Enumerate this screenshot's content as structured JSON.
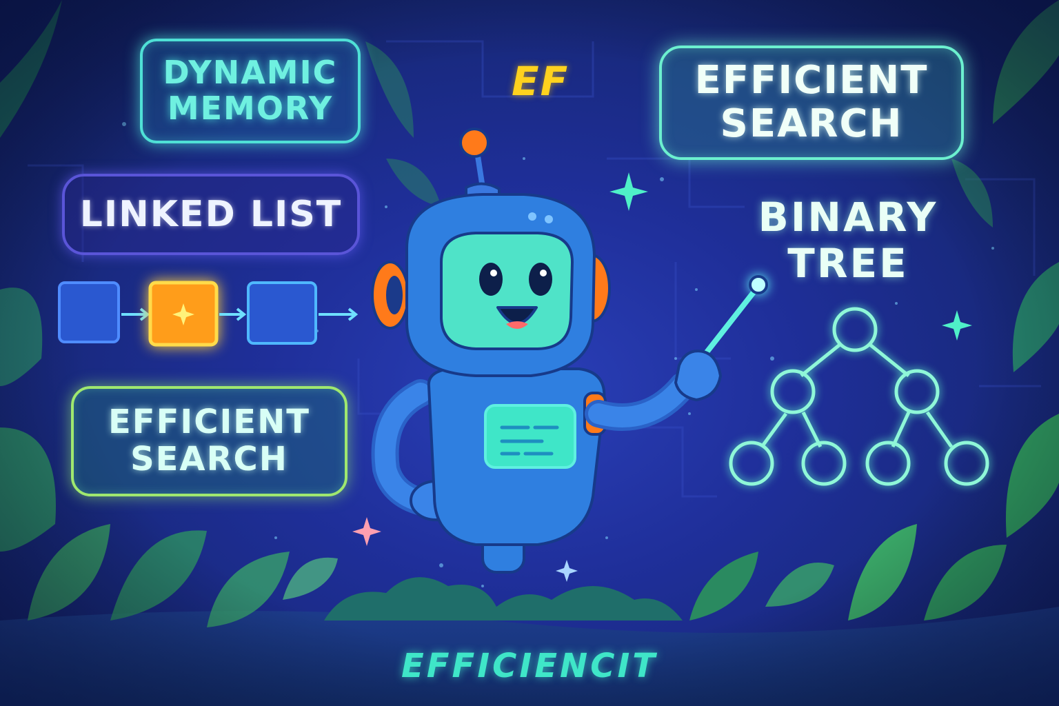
{
  "brand": {
    "logo_text": "EF",
    "footer_text": "EFFICIENCIT"
  },
  "labels": {
    "dynamic_memory": [
      "DYNAMIC",
      "MEMORY"
    ],
    "linked_list": "LINKED LIST",
    "efficient_search_left": [
      "EFFICIENT",
      "SEARCH"
    ],
    "efficient_search_right": [
      "EFFICIENT",
      "SEARCH"
    ],
    "binary_tree": [
      "BINARY",
      "TREE"
    ]
  },
  "colors": {
    "background": "#1f2f9a",
    "robot_body": "#2f7fe0",
    "robot_face": "#4fe3c8",
    "robot_accent": "#ff7a1a",
    "node_highlight": "#ffa81f",
    "node_default": "#2060d8",
    "glow_cyan": "#4fe0d6",
    "logo_yellow": "#ffd21e"
  },
  "icons": [
    "robot-mascot-icon",
    "sparkle-icon",
    "leaf-icon",
    "arrow-right-icon"
  ]
}
